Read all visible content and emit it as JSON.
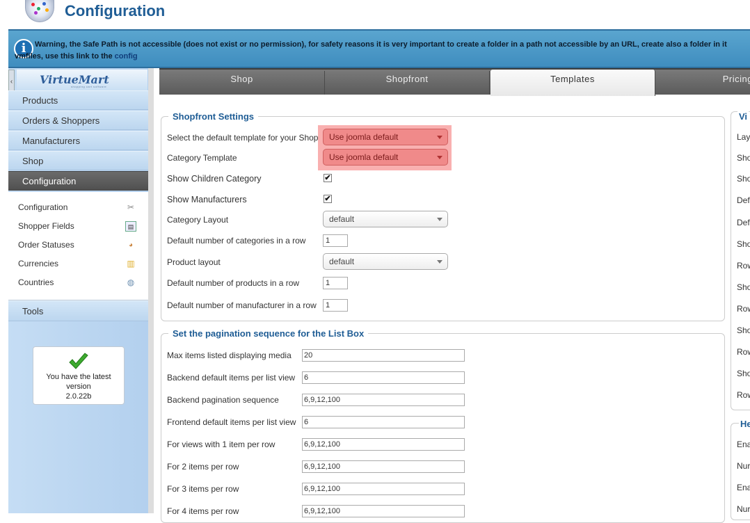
{
  "header": {
    "title": "Configuration"
  },
  "warning": {
    "text": "Warning, the Safe Path is not accessible (does not exist or no permission), for safety reasons it is very important to create a folder in a path not accessible by an URL, create also a folder in it vmfiles, use this link to the ",
    "link": "config"
  },
  "sidebar": {
    "logo": "VirtueMart",
    "logo_sub": "shopping cart software",
    "items": [
      {
        "label": "Products"
      },
      {
        "label": "Orders & Shoppers"
      },
      {
        "label": "Manufacturers"
      },
      {
        "label": "Shop"
      },
      {
        "label": "Configuration"
      }
    ],
    "subitems": [
      {
        "label": "Configuration",
        "icon": "tools-icon"
      },
      {
        "label": "Shopper Fields",
        "icon": "user-fields-icon"
      },
      {
        "label": "Order Statuses",
        "icon": "order-status-icon"
      },
      {
        "label": "Currencies",
        "icon": "coins-icon"
      },
      {
        "label": "Countries",
        "icon": "globe-icon"
      }
    ],
    "tools": "Tools",
    "version": {
      "line1": "You have the latest",
      "line2": "version",
      "number": "2.0.22b"
    }
  },
  "tabs": [
    {
      "label": "Shop"
    },
    {
      "label": "Shopfront"
    },
    {
      "label": "Templates"
    },
    {
      "label": "Pricing"
    }
  ],
  "shopfront": {
    "legend": "Shopfront Settings",
    "default_template_label": "Select the default template for your Shop",
    "default_template_value": "Use joomla default",
    "category_template_label": "Category Template",
    "category_template_value": "Use joomla default",
    "show_children_label": "Show Children Category",
    "show_children_checked": true,
    "show_manufacturers_label": "Show Manufacturers",
    "show_manufacturers_checked": true,
    "category_layout_label": "Category Layout",
    "category_layout_value": "default",
    "cats_per_row_label": "Default number of categories in a row",
    "cats_per_row_value": "1",
    "product_layout_label": "Product layout",
    "product_layout_value": "default",
    "products_per_row_label": "Default number of products in a row",
    "products_per_row_value": "1",
    "manufacturers_per_row_label": "Default number of manufacturer in a row",
    "manufacturers_per_row_value": "1"
  },
  "pagination": {
    "legend": "Set the pagination sequence for the List Box",
    "rows": [
      {
        "label": "Max items listed displaying media",
        "value": "20"
      },
      {
        "label": "Backend default items per list view",
        "value": "6"
      },
      {
        "label": "Backend pagination sequence",
        "value": "6,9,12,100"
      },
      {
        "label": "Frontend default items per list view",
        "value": "6"
      },
      {
        "label": "For views with 1 item per row",
        "value": "6,9,12,100"
      },
      {
        "label": "For 2 items per row",
        "value": "6,9,12,100"
      },
      {
        "label": "For 3 items per row",
        "value": "6,9,12,100"
      },
      {
        "label": "For 4 items per row",
        "value": "6,9,12,100"
      }
    ]
  },
  "right_column": {
    "legend1": "Vi",
    "labels": [
      "Lay",
      "Sho",
      "Sho",
      "Def",
      "Def",
      "Sho",
      "Row",
      "Sho",
      "Row",
      "Sho",
      "Row",
      "Sho",
      "Row"
    ],
    "legend2": "He",
    "labels2": [
      "Ena",
      "Nur",
      "Ena",
      "Nur"
    ]
  }
}
